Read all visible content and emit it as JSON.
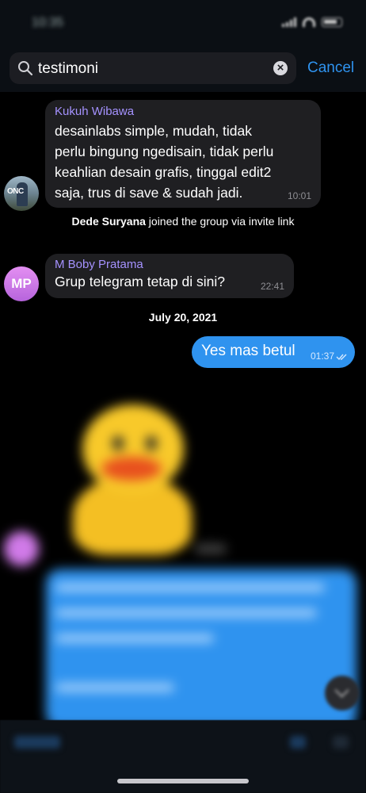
{
  "search": {
    "query": "testimoni",
    "cancel_label": "Cancel"
  },
  "messages": [
    {
      "sender": "Kukuh Wibawa",
      "lines": [
        "desainlabs simple, mudah, tidak",
        "perlu bingung ngedisain, tidak perlu",
        "keahlian desain grafis, tinggal edit2",
        "saja, trus di save & sudah jadi."
      ],
      "time": "10:01"
    },
    {
      "sender": "M Boby Pratama",
      "avatar_initials": "MP",
      "text": "Grup telegram tetap di sini?",
      "time": "22:41"
    },
    {
      "text": "Yes mas betul",
      "time": "01:37"
    }
  ],
  "service_message": {
    "name": "Dede Suryana",
    "text": "joined the group via invite link"
  },
  "avatar_photo_text": "ONC",
  "date_separator": "July 20, 2021",
  "colors": {
    "accent": "#2f93ef",
    "incoming_bubble": "#1f1f22",
    "sender_name": "#a592ff",
    "outgoing_bubble": "#2f93ef"
  },
  "icons": [
    "search-icon",
    "clear-icon",
    "read-receipt-icon",
    "scroll-down-icon"
  ]
}
